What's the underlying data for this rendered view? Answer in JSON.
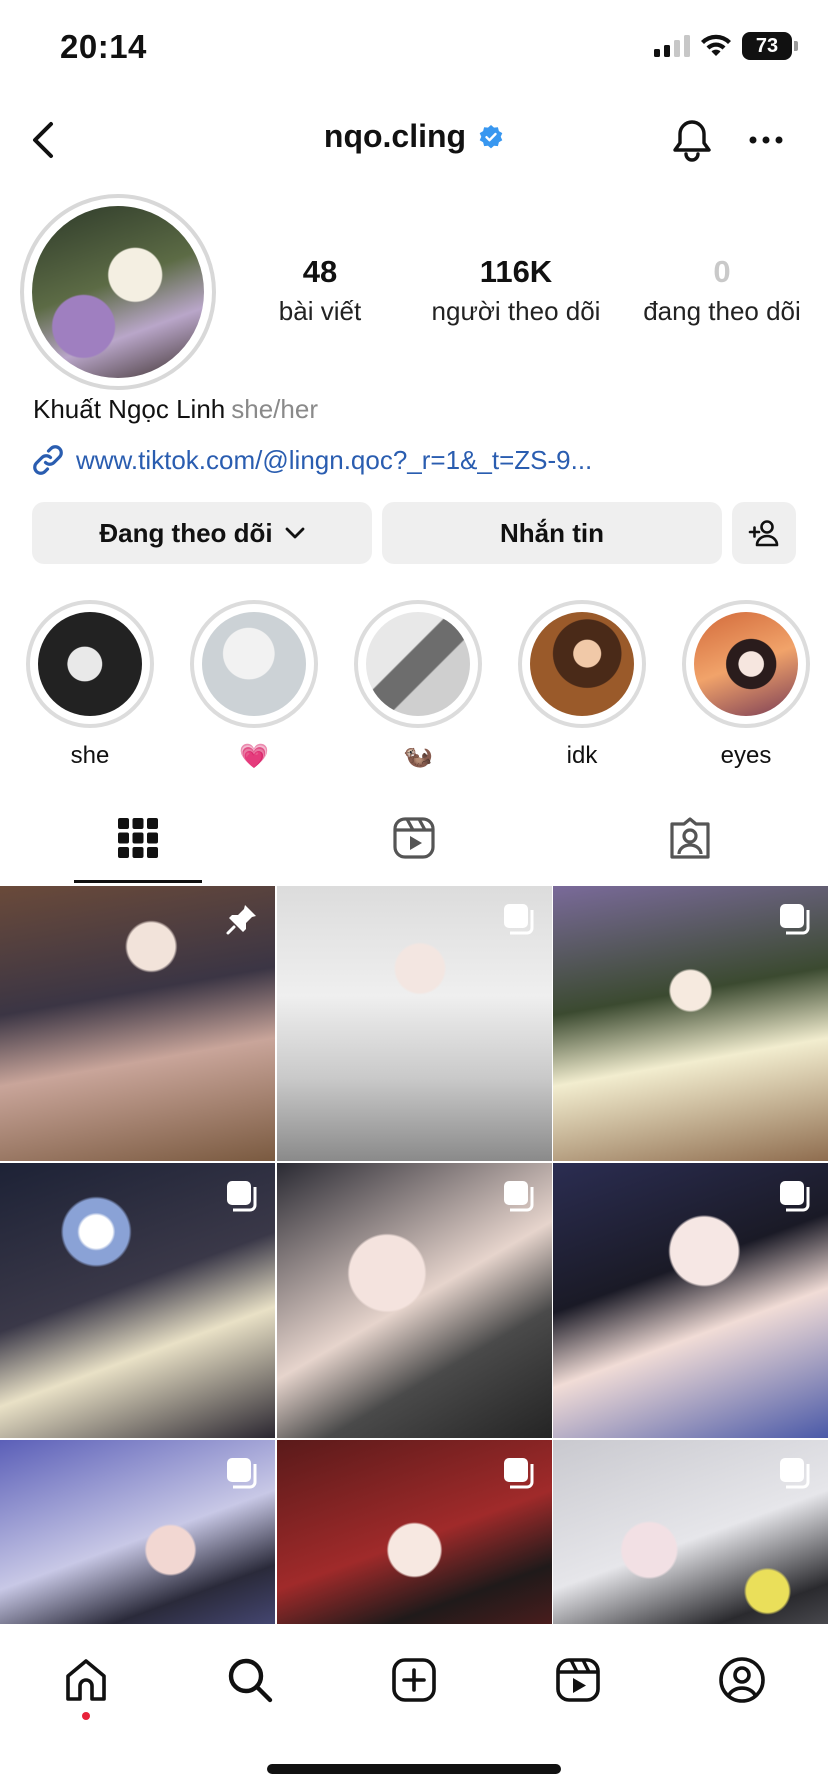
{
  "status_bar": {
    "time": "20:14",
    "battery": "73"
  },
  "header": {
    "username": "nqo.cling"
  },
  "profile": {
    "full_name": "Khuất Ngọc Linh",
    "pronouns": "she/her",
    "link": "www.tiktok.com/@lingn.qoc?_r=1&_t=ZS-9...",
    "stats": {
      "posts": {
        "value": "48",
        "label": "bài viết"
      },
      "followers": {
        "value": "116K",
        "label": "người theo dõi"
      },
      "following": {
        "value": "0",
        "label": "đang theo dõi"
      }
    }
  },
  "actions": {
    "following_label": "Đang theo dõi",
    "message_label": "Nhắn tin"
  },
  "highlights": [
    {
      "label": "she"
    },
    {
      "label": "💗"
    },
    {
      "label": "🦦"
    },
    {
      "label": "idk"
    },
    {
      "label": "eyes"
    }
  ],
  "tabs": [
    {
      "icon": "grid-icon",
      "active": true
    },
    {
      "icon": "reels-icon",
      "active": false
    },
    {
      "icon": "tagged-icon",
      "active": false
    }
  ],
  "grid_posts": [
    {
      "badge": "pin-icon"
    },
    {
      "badge": "carousel-icon"
    },
    {
      "badge": "carousel-icon"
    },
    {
      "badge": "carousel-icon"
    },
    {
      "badge": "carousel-icon"
    },
    {
      "badge": "carousel-icon"
    },
    {
      "badge": "carousel-icon"
    },
    {
      "badge": "carousel-icon"
    },
    {
      "badge": "carousel-icon"
    }
  ],
  "bottom_nav": [
    "home-icon",
    "search-icon",
    "create-icon",
    "reels-icon",
    "profile-icon"
  ],
  "colors": {
    "link": "#2a5db0",
    "verified": "#3897f0",
    "button_bg": "#efefef",
    "notification_dot": "#e8223a"
  }
}
